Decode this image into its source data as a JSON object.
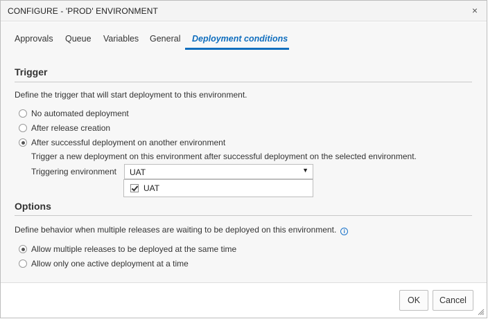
{
  "dialog": {
    "title": "CONFIGURE - 'PROD' ENVIRONMENT",
    "close_glyph": "×"
  },
  "tabs": [
    {
      "label": "Approvals",
      "active": false
    },
    {
      "label": "Queue",
      "active": false
    },
    {
      "label": "Variables",
      "active": false
    },
    {
      "label": "General",
      "active": false
    },
    {
      "label": "Deployment conditions",
      "active": true
    }
  ],
  "trigger": {
    "heading": "Trigger",
    "description": "Define the trigger that will start deployment to this environment.",
    "options": [
      {
        "label": "No automated deployment",
        "selected": false
      },
      {
        "label": "After release creation",
        "selected": false
      },
      {
        "label": "After successful deployment on another environment",
        "selected": true
      }
    ],
    "subtext": "Trigger a new deployment on this environment after successful deployment on the selected environment.",
    "field_label": "Triggering environment",
    "select_value": "UAT",
    "dropdown_items": [
      {
        "label": "UAT",
        "checked": true
      }
    ]
  },
  "options": {
    "heading": "Options",
    "description": "Define behavior when multiple releases are waiting to be deployed on this environment.",
    "items": [
      {
        "label": "Allow multiple releases to be deployed at the same time",
        "selected": true
      },
      {
        "label": "Allow only one active deployment at a time",
        "selected": false
      }
    ]
  },
  "footer": {
    "ok_label": "OK",
    "cancel_label": "Cancel"
  },
  "colors": {
    "accent": "#106ebe",
    "info": "#1a73c9"
  },
  "icons": {
    "close": "close-icon",
    "caret": "chevron-down-icon",
    "info": "info-icon",
    "check": "checkmark-icon",
    "grip": "resize-grip-icon"
  }
}
